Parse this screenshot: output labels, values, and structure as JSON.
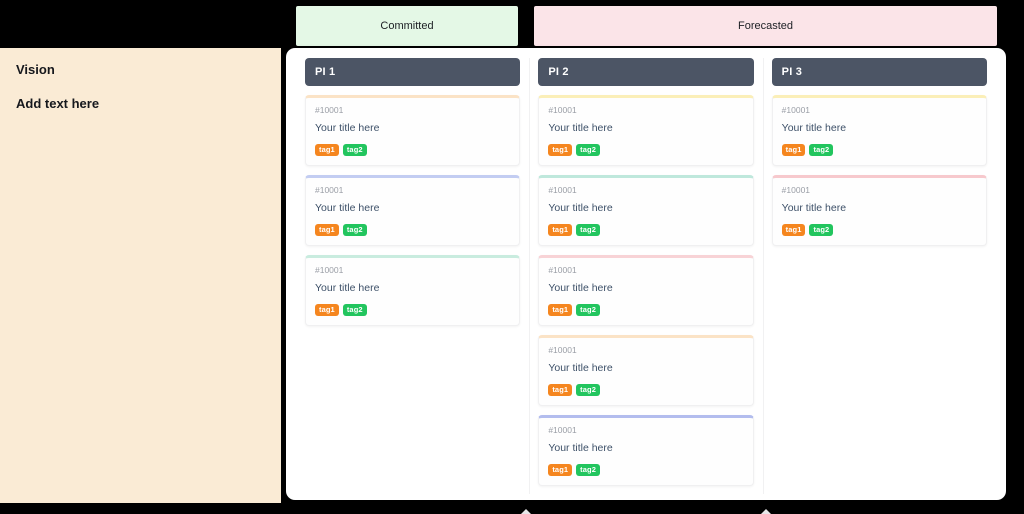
{
  "vision_panel": {
    "title": "Vision",
    "text": "Add text here",
    "background_color": "#faebd5"
  },
  "bands": [
    {
      "label": "Committed",
      "color": "#e4f8e6"
    },
    {
      "label": "Forecasted",
      "color": "#fbe4e8"
    }
  ],
  "tag_colors": {
    "tag1": "#f5861f",
    "tag2": "#22c55e"
  },
  "header_color": "#4c5565",
  "columns": [
    {
      "title": "PI 1",
      "cards": [
        {
          "id": "#10001",
          "title": "Your title here",
          "accent": "#fbe3c6",
          "tags": [
            "tag1",
            "tag2"
          ]
        },
        {
          "id": "#10001",
          "title": "Your title here",
          "accent": "#c3cdf2",
          "tags": [
            "tag1",
            "tag2"
          ]
        },
        {
          "id": "#10001",
          "title": "Your title here",
          "accent": "#c9ecdf",
          "tags": [
            "tag1",
            "tag2"
          ]
        }
      ]
    },
    {
      "title": "PI 2",
      "cards": [
        {
          "id": "#10001",
          "title": "Your title here",
          "accent": "#fbefb8",
          "tags": [
            "tag1",
            "tag2"
          ]
        },
        {
          "id": "#10001",
          "title": "Your title here",
          "accent": "#bfe8dc",
          "tags": [
            "tag1",
            "tag2"
          ]
        },
        {
          "id": "#10001",
          "title": "Your title here",
          "accent": "#f8d3d6",
          "tags": [
            "tag1",
            "tag2"
          ]
        },
        {
          "id": "#10001",
          "title": "Your title here",
          "accent": "#fbe3c6",
          "tags": [
            "tag1",
            "tag2"
          ]
        },
        {
          "id": "#10001",
          "title": "Your title here",
          "accent": "#b3bdee",
          "tags": [
            "tag1",
            "tag2"
          ]
        }
      ]
    },
    {
      "title": "PI 3",
      "cards": [
        {
          "id": "#10001",
          "title": "Your title here",
          "accent": "#fbefb8",
          "tags": [
            "tag1",
            "tag2"
          ]
        },
        {
          "id": "#10001",
          "title": "Your title here",
          "accent": "#f7c9cd",
          "tags": [
            "tag1",
            "tag2"
          ]
        }
      ]
    }
  ]
}
